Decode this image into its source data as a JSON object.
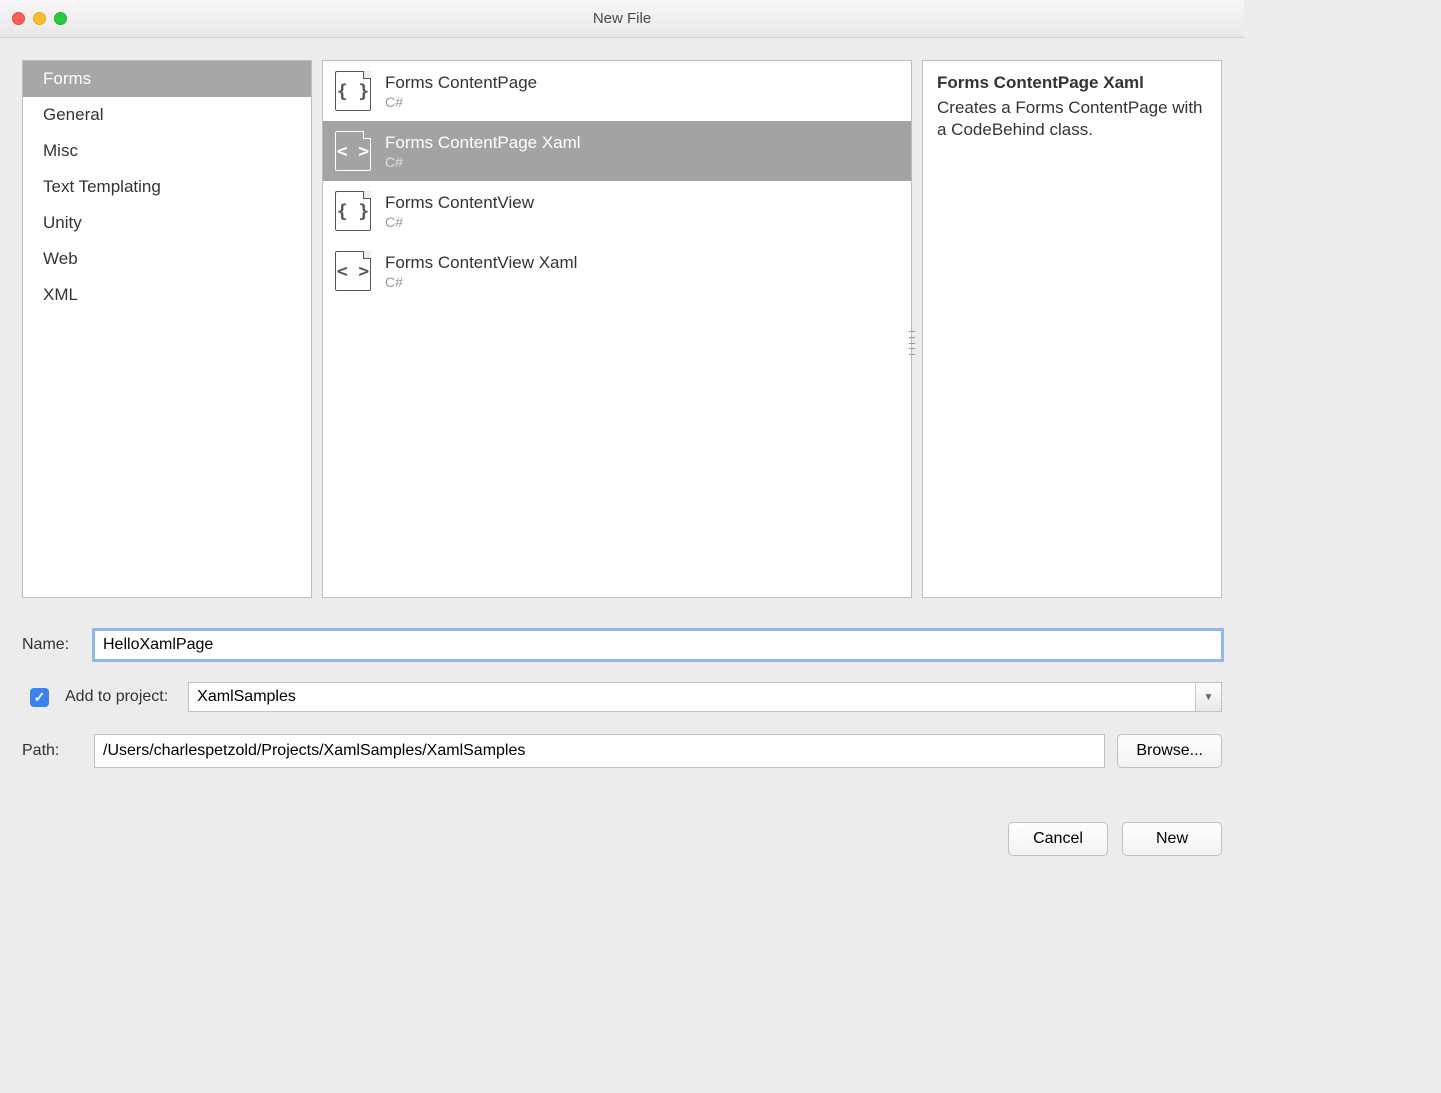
{
  "window": {
    "title": "New File"
  },
  "categories": [
    "Forms",
    "General",
    "Misc",
    "Text Templating",
    "Unity",
    "Web",
    "XML"
  ],
  "selectedCategoryIndex": 0,
  "templates": [
    {
      "name": "Forms ContentPage",
      "lang": "C#",
      "glyph": "{ }"
    },
    {
      "name": "Forms ContentPage Xaml",
      "lang": "C#",
      "glyph": "< >"
    },
    {
      "name": "Forms ContentView",
      "lang": "C#",
      "glyph": "{ }"
    },
    {
      "name": "Forms ContentView Xaml",
      "lang": "C#",
      "glyph": "< >"
    }
  ],
  "selectedTemplateIndex": 1,
  "description": {
    "title": "Forms ContentPage Xaml",
    "body": "Creates a Forms ContentPage with a CodeBehind class."
  },
  "form": {
    "name_label": "Name:",
    "name_value": "HelloXamlPage",
    "add_to_project_label": "Add to project:",
    "add_to_project_checked": true,
    "project_value": "XamlSamples",
    "path_label": "Path:",
    "path_value": "/Users/charlespetzold/Projects/XamlSamples/XamlSamples",
    "browse_label": "Browse..."
  },
  "buttons": {
    "cancel": "Cancel",
    "new": "New"
  }
}
